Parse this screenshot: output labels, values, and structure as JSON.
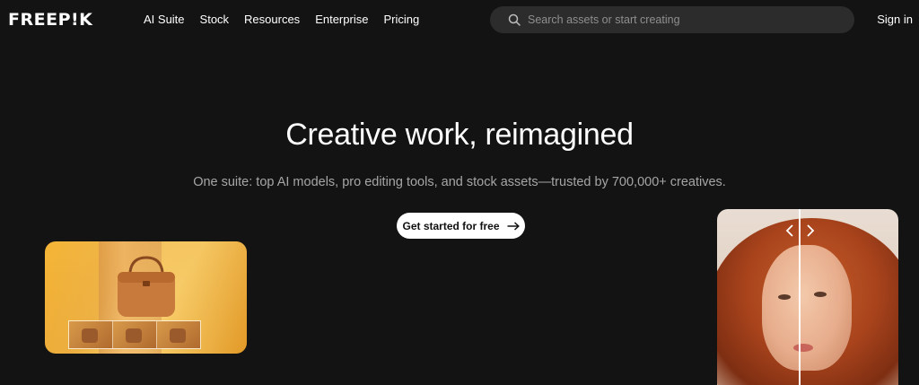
{
  "header": {
    "logo": "FREEP!K",
    "nav": [
      "AI Suite",
      "Stock",
      "Resources",
      "Enterprise",
      "Pricing"
    ],
    "search_placeholder": "Search assets or start creating",
    "signin": "Sign in"
  },
  "hero": {
    "title": "Creative work, reimagined",
    "subtitle": "One suite: top AI models, pro editing tools, and stock assets—trusted by 700,000+ creatives.",
    "cta": "Get started for free"
  },
  "icons": {
    "search": "search-icon",
    "cta_arrow": "arrow-right-icon",
    "compare_left": "chevron-left-icon",
    "compare_right": "chevron-right-icon"
  },
  "colors": {
    "background": "#131313",
    "search_bg": "#2c2c2c",
    "cta_bg": "#ffffff",
    "subtitle": "#a6a6a6"
  }
}
